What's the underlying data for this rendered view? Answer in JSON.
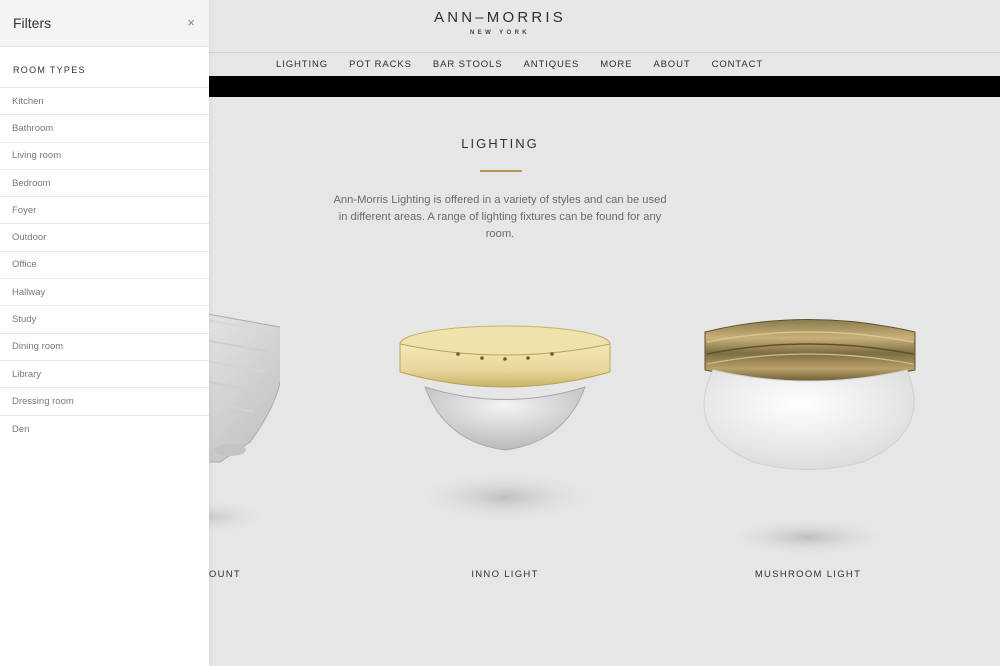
{
  "header": {
    "logo_main": "ANN–MORRIS",
    "logo_sub": "NEW YORK"
  },
  "nav": {
    "items": [
      "LIGHTING",
      "POT RACKS",
      "BAR STOOLS",
      "ANTIQUES",
      "MORE",
      "ABOUT",
      "CONTACT"
    ]
  },
  "main": {
    "title": "LIGHTING",
    "intro": "Ann-Morris Lighting is offered in a variety of styles and can be used in different areas. A range of lighting fixtures can be found for any room.",
    "products": [
      {
        "name": "OUNT"
      },
      {
        "name": "INNO LIGHT"
      },
      {
        "name": "MUSHROOM LIGHT"
      }
    ],
    "accent_color": "#b59a53"
  },
  "filters": {
    "title": "Filters",
    "close": "×",
    "section_title": "ROOM TYPES",
    "room_types": [
      "Kitchen",
      "Bathroom",
      "Living room",
      "Bedroom",
      "Foyer",
      "Outdoor",
      "Office",
      "Hallway",
      "Study",
      "Dining room",
      "Library",
      "Dressing room",
      "Den"
    ]
  }
}
